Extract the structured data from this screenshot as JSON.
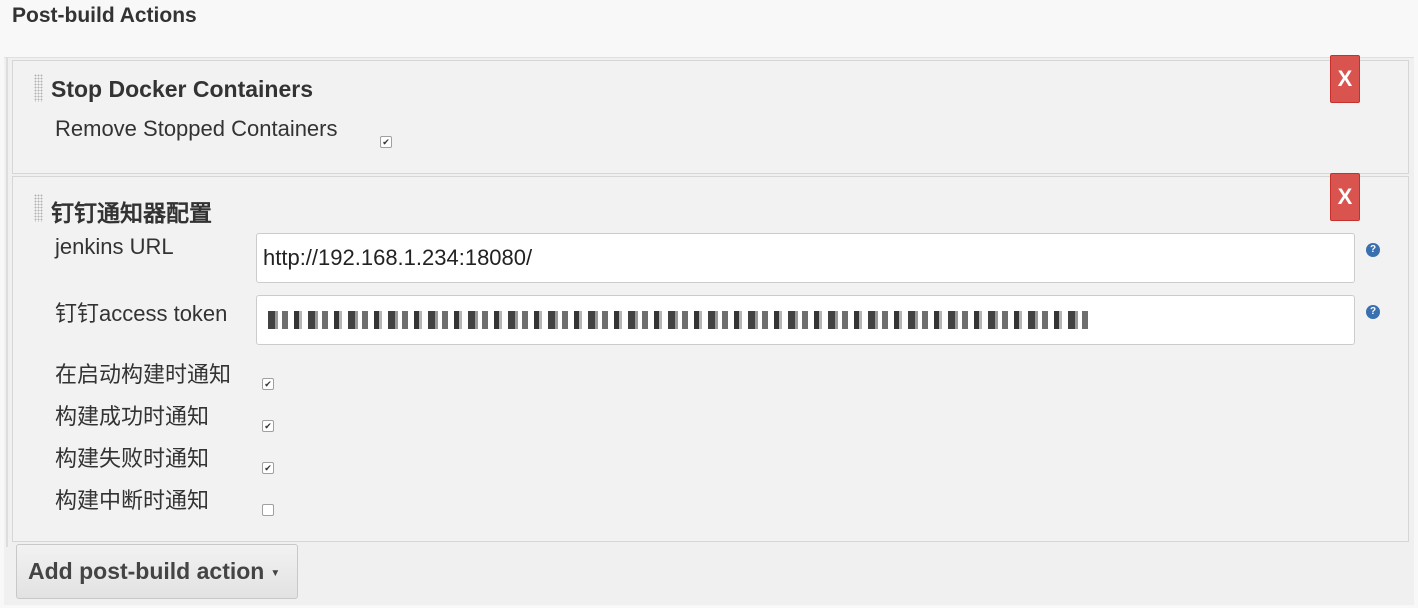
{
  "section": {
    "title": "Post-build Actions"
  },
  "docker": {
    "title": "Stop Docker Containers",
    "delete_label": "X",
    "remove_stopped": {
      "label": "Remove Stopped Containers",
      "checked": true
    }
  },
  "dingtalk": {
    "title": "钉钉通知器配置",
    "delete_label": "X",
    "jenkins_url": {
      "label": "jenkins URL",
      "value": "http://192.168.1.234:18080/"
    },
    "access_token": {
      "label": "钉钉access token"
    },
    "options": [
      {
        "label": "在启动构建时通知",
        "checked": true
      },
      {
        "label": "构建成功时通知",
        "checked": true
      },
      {
        "label": "构建失败时通知",
        "checked": true
      },
      {
        "label": "构建中断时通知",
        "checked": false
      }
    ],
    "help_icon": "?"
  },
  "add_button": {
    "label": "Add post-build action",
    "icon": "caret-down-icon"
  },
  "colors": {
    "delete": "#d9534f",
    "help": "#3a6fb0"
  }
}
